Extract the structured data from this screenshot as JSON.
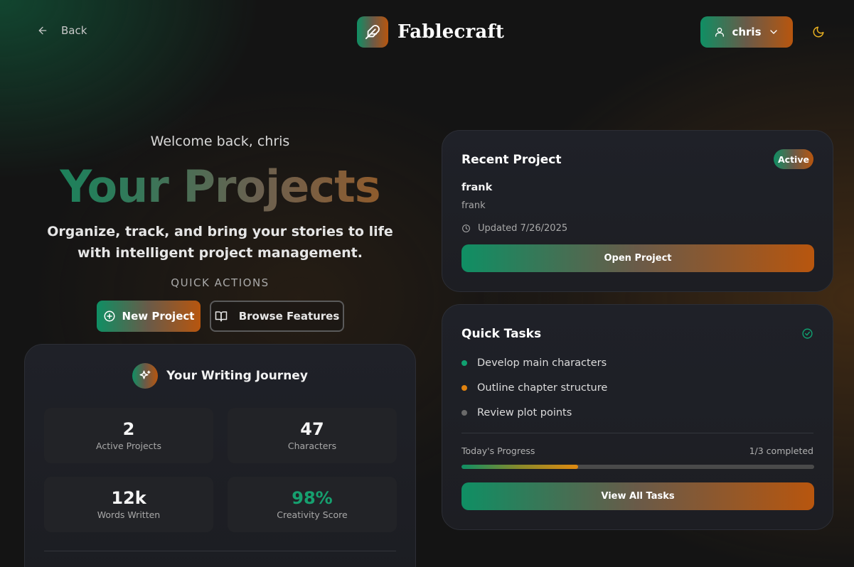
{
  "header": {
    "back_label": "Back",
    "brand_name": "Fablecraft",
    "user_name": "chris"
  },
  "hero": {
    "welcome": "Welcome back, chris",
    "title": "Your Projects",
    "tagline": "Organize, track, and bring your stories to life with intelligent project management.",
    "quick_actions_label": "QUICK ACTIONS",
    "new_project_label": "New Project",
    "browse_features_label": "Browse Features"
  },
  "journey": {
    "title": "Your Writing Journey",
    "stats": [
      {
        "value": "2",
        "label": "Active Projects"
      },
      {
        "value": "47",
        "label": "Characters"
      },
      {
        "value": "12k",
        "label": "Words Written"
      },
      {
        "value": "98%",
        "label": "Creativity Score"
      }
    ]
  },
  "recent_project": {
    "title": "Recent Project",
    "status": "Active",
    "name": "frank",
    "subtitle": "frank",
    "updated": "Updated 7/26/2025",
    "open_label": "Open Project"
  },
  "quick_tasks": {
    "title": "Quick Tasks",
    "tasks": [
      {
        "label": "Develop main characters",
        "color": "#10a070"
      },
      {
        "label": "Outline chapter structure",
        "color": "#e0820e"
      },
      {
        "label": "Review plot points",
        "color": "#6a6a6a"
      }
    ],
    "progress_label": "Today's Progress",
    "progress_count": "1/3 completed",
    "progress_fraction": 0.33,
    "view_all_label": "View All Tasks"
  },
  "colors": {
    "accent_green": "#0f8f64",
    "accent_orange": "#b8560e",
    "background": "#141414",
    "card": "#1f2128"
  }
}
